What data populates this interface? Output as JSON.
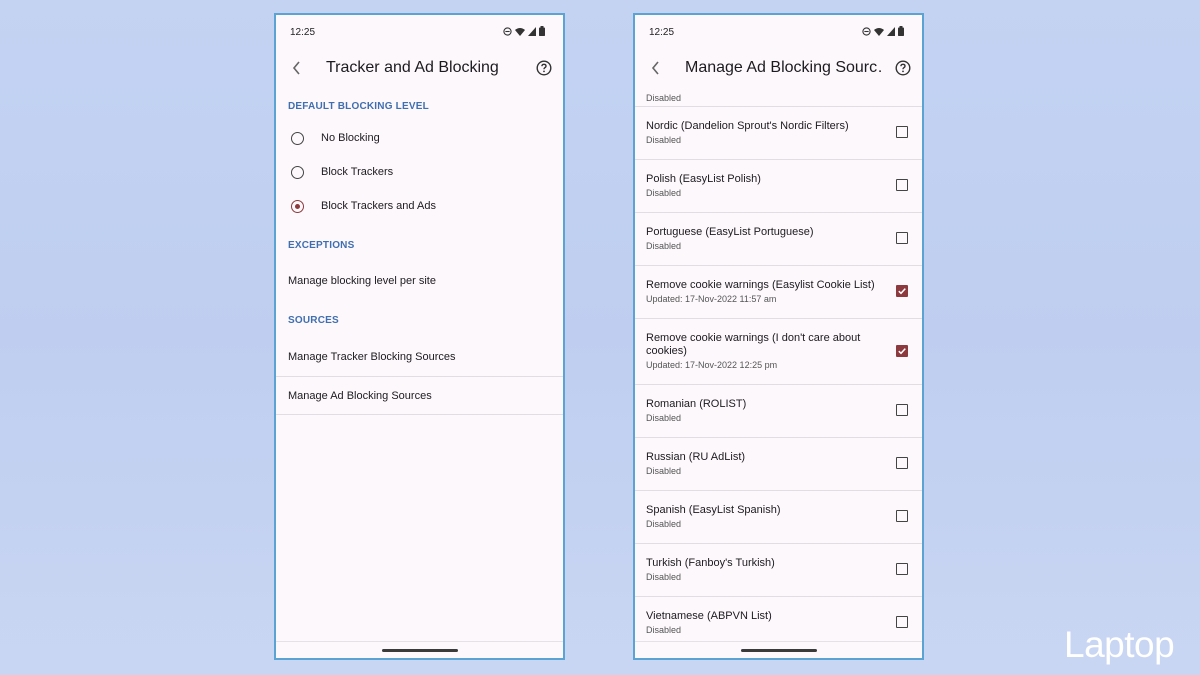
{
  "left_screen": {
    "status_time": "12:25",
    "title": "Tracker and Ad Blocking",
    "sections": {
      "default_blocking_level": "DEFAULT BLOCKING LEVEL",
      "exceptions": "EXCEPTIONS",
      "sources": "SOURCES"
    },
    "blocking_options": [
      {
        "label": "No Blocking",
        "selected": false
      },
      {
        "label": "Block Trackers",
        "selected": false
      },
      {
        "label": "Block Trackers and Ads",
        "selected": true
      }
    ],
    "exceptions_item": "Manage blocking level per site",
    "source_items": [
      "Manage Tracker Blocking Sources",
      "Manage Ad Blocking Sources"
    ]
  },
  "right_screen": {
    "status_time": "12:25",
    "title": "Manage Ad Blocking Sourc…",
    "partial_item_status": "Disabled",
    "sources": [
      {
        "title": "Nordic (Dandelion Sprout's Nordic Filters)",
        "status": "Disabled",
        "checked": false
      },
      {
        "title": "Polish (EasyList Polish)",
        "status": "Disabled",
        "checked": false
      },
      {
        "title": "Portuguese (EasyList Portuguese)",
        "status": "Disabled",
        "checked": false
      },
      {
        "title": "Remove cookie warnings (Easylist Cookie List)",
        "status": "Updated: 17-Nov-2022 11:57 am",
        "checked": true
      },
      {
        "title": "Remove cookie warnings (I don't care about cookies)",
        "status": "Updated: 17-Nov-2022 12:25 pm",
        "checked": true
      },
      {
        "title": "Romanian (ROLIST)",
        "status": "Disabled",
        "checked": false
      },
      {
        "title": "Russian (RU AdList)",
        "status": "Disabled",
        "checked": false
      },
      {
        "title": "Spanish (EasyList Spanish)",
        "status": "Disabled",
        "checked": false
      },
      {
        "title": "Turkish (Fanboy's Turkish)",
        "status": "Disabled",
        "checked": false
      },
      {
        "title": "Vietnamese (ABPVN List)",
        "status": "Disabled",
        "checked": false
      }
    ]
  },
  "watermark": "Laptop",
  "colors": {
    "accent": "#8c3a3d",
    "section_header": "#3f6fb0",
    "phone_border": "#5ba3d3",
    "background": "#c4d3f2"
  },
  "icons": [
    "back-arrow-icon",
    "help-icon",
    "do-not-disturb-icon",
    "wifi-icon",
    "signal-icon",
    "battery-icon",
    "checkmark-icon"
  ]
}
